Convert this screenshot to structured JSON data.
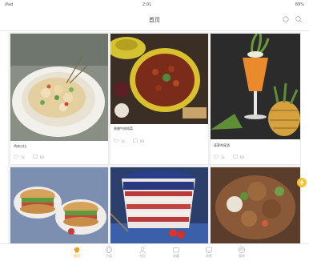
{
  "status_bar": {
    "carrier": "iPad",
    "time": "2:01",
    "battery": "89%"
  },
  "nav": {
    "title": "首页",
    "left_icon": "none",
    "right_icons": [
      "share-icon",
      "search-icon"
    ]
  },
  "cards": [
    {
      "caption": "鸡肉沙拉",
      "likes": "1k",
      "comments": "68"
    },
    {
      "caption": "香辣牛肉炖菜",
      "likes": "1k",
      "comments": "68"
    },
    {
      "caption": "菠萝鸡尾酒",
      "likes": "1k",
      "comments": "68"
    },
    {
      "caption": "",
      "likes": "",
      "comments": ""
    },
    {
      "caption": "",
      "likes": "",
      "comments": ""
    },
    {
      "caption": "",
      "likes": "",
      "comments": ""
    }
  ],
  "fab": {
    "icon": "plus-icon"
  },
  "tabbar": {
    "tabs": [
      {
        "label": "首页",
        "icon": "chef-hat-icon"
      },
      {
        "label": "分类",
        "icon": "globe-icon"
      },
      {
        "label": "社区",
        "icon": "people-icon"
      },
      {
        "label": "收藏",
        "icon": "folder-icon"
      },
      {
        "label": "消息",
        "icon": "message-icon"
      },
      {
        "label": "我的",
        "icon": "user-icon"
      }
    ]
  },
  "colors": {
    "accent": "#f0a31a",
    "fab": "#f5c232"
  }
}
